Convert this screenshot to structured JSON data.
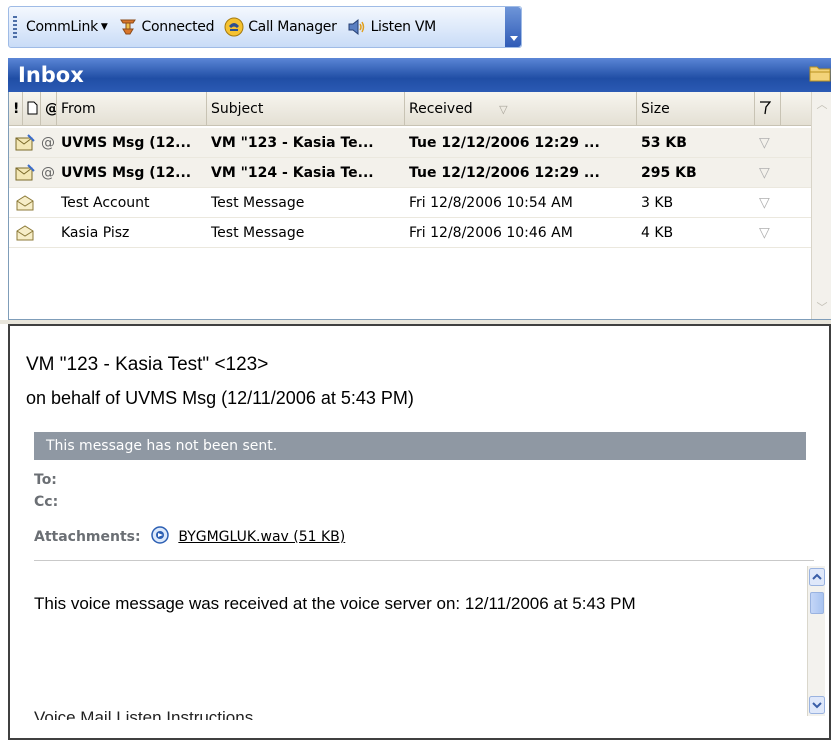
{
  "toolbar": {
    "commlink_label": "CommLink",
    "connected_label": "Connected",
    "call_manager_label": "Call Manager",
    "listen_vm_label": "Listen VM"
  },
  "inbox": {
    "title": "Inbox",
    "columns": {
      "importance": "!",
      "from": "From",
      "subject": "Subject",
      "received": "Received",
      "size": "Size"
    },
    "messages": [
      {
        "from": "UVMS Msg  (12...",
        "subject": "VM  \"123 - Kasia Te...",
        "received": "Tue 12/12/2006 12:29 ...",
        "size": "53 KB",
        "unread": true,
        "has_attachment": true
      },
      {
        "from": "UVMS Msg  (12...",
        "subject": "VM  \"124 - Kasia Te...",
        "received": "Tue 12/12/2006 12:29 ...",
        "size": "295 KB",
        "unread": true,
        "has_attachment": true
      },
      {
        "from": "Test Account",
        "subject": "Test Message",
        "received": "Fri 12/8/2006 10:54 AM",
        "size": "3 KB",
        "unread": false,
        "has_attachment": false
      },
      {
        "from": "Kasia Pisz",
        "subject": "Test Message",
        "received": "Fri 12/8/2006 10:46 AM",
        "size": "4 KB",
        "unread": false,
        "has_attachment": false
      }
    ]
  },
  "reading_pane": {
    "subject": "VM  \"123 - Kasia Test\" <123>",
    "behalf": "on behalf of UVMS Msg  (12/11/2006 at 5:43 PM)",
    "infobar": "This message has not been sent.",
    "to_label": "To:",
    "cc_label": "Cc:",
    "attachments_label": "Attachments:",
    "attachment_name": "BYGMGLUK.wav (51 KB)",
    "body_line1": "This voice message was received at the voice server on: 12/11/2006 at 5:43 PM",
    "body_line2": "Voice Mail Listen Instructions"
  },
  "colors": {
    "header_blue": "#204ea5",
    "toolbar_bg": "#c9dcf7",
    "infobar_gray": "#8f98a3"
  }
}
